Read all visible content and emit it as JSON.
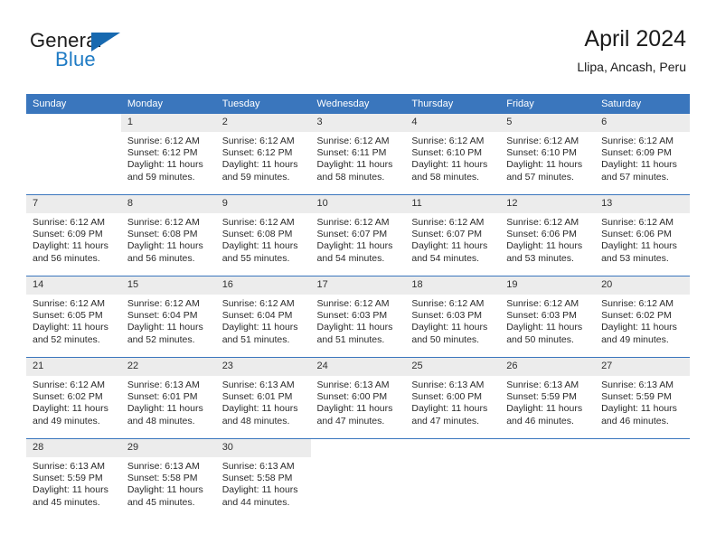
{
  "brand": {
    "name_part1": "General",
    "name_part2": "Blue",
    "triangle_color": "#1769b0",
    "blue_color": "#1f7bc4"
  },
  "header": {
    "title": "April 2024",
    "subtitle": "Llipa, Ancash, Peru"
  },
  "theme": {
    "header_bg": "#3a76bd",
    "daynum_bg": "#ececec",
    "cell_bg": "#ffffff",
    "text_color": "#2a2a2a"
  },
  "weekday_headers": [
    "Sunday",
    "Monday",
    "Tuesday",
    "Wednesday",
    "Thursday",
    "Friday",
    "Saturday"
  ],
  "weeks": [
    [
      {
        "day": "",
        "sunrise": "",
        "sunset": "",
        "daylight": "",
        "empty": true
      },
      {
        "day": "1",
        "sunrise": "Sunrise: 6:12 AM",
        "sunset": "Sunset: 6:12 PM",
        "daylight": "Daylight: 11 hours and 59 minutes.",
        "empty": false
      },
      {
        "day": "2",
        "sunrise": "Sunrise: 6:12 AM",
        "sunset": "Sunset: 6:12 PM",
        "daylight": "Daylight: 11 hours and 59 minutes.",
        "empty": false
      },
      {
        "day": "3",
        "sunrise": "Sunrise: 6:12 AM",
        "sunset": "Sunset: 6:11 PM",
        "daylight": "Daylight: 11 hours and 58 minutes.",
        "empty": false
      },
      {
        "day": "4",
        "sunrise": "Sunrise: 6:12 AM",
        "sunset": "Sunset: 6:10 PM",
        "daylight": "Daylight: 11 hours and 58 minutes.",
        "empty": false
      },
      {
        "day": "5",
        "sunrise": "Sunrise: 6:12 AM",
        "sunset": "Sunset: 6:10 PM",
        "daylight": "Daylight: 11 hours and 57 minutes.",
        "empty": false
      },
      {
        "day": "6",
        "sunrise": "Sunrise: 6:12 AM",
        "sunset": "Sunset: 6:09 PM",
        "daylight": "Daylight: 11 hours and 57 minutes.",
        "empty": false
      }
    ],
    [
      {
        "day": "7",
        "sunrise": "Sunrise: 6:12 AM",
        "sunset": "Sunset: 6:09 PM",
        "daylight": "Daylight: 11 hours and 56 minutes.",
        "empty": false
      },
      {
        "day": "8",
        "sunrise": "Sunrise: 6:12 AM",
        "sunset": "Sunset: 6:08 PM",
        "daylight": "Daylight: 11 hours and 56 minutes.",
        "empty": false
      },
      {
        "day": "9",
        "sunrise": "Sunrise: 6:12 AM",
        "sunset": "Sunset: 6:08 PM",
        "daylight": "Daylight: 11 hours and 55 minutes.",
        "empty": false
      },
      {
        "day": "10",
        "sunrise": "Sunrise: 6:12 AM",
        "sunset": "Sunset: 6:07 PM",
        "daylight": "Daylight: 11 hours and 54 minutes.",
        "empty": false
      },
      {
        "day": "11",
        "sunrise": "Sunrise: 6:12 AM",
        "sunset": "Sunset: 6:07 PM",
        "daylight": "Daylight: 11 hours and 54 minutes.",
        "empty": false
      },
      {
        "day": "12",
        "sunrise": "Sunrise: 6:12 AM",
        "sunset": "Sunset: 6:06 PM",
        "daylight": "Daylight: 11 hours and 53 minutes.",
        "empty": false
      },
      {
        "day": "13",
        "sunrise": "Sunrise: 6:12 AM",
        "sunset": "Sunset: 6:06 PM",
        "daylight": "Daylight: 11 hours and 53 minutes.",
        "empty": false
      }
    ],
    [
      {
        "day": "14",
        "sunrise": "Sunrise: 6:12 AM",
        "sunset": "Sunset: 6:05 PM",
        "daylight": "Daylight: 11 hours and 52 minutes.",
        "empty": false
      },
      {
        "day": "15",
        "sunrise": "Sunrise: 6:12 AM",
        "sunset": "Sunset: 6:04 PM",
        "daylight": "Daylight: 11 hours and 52 minutes.",
        "empty": false
      },
      {
        "day": "16",
        "sunrise": "Sunrise: 6:12 AM",
        "sunset": "Sunset: 6:04 PM",
        "daylight": "Daylight: 11 hours and 51 minutes.",
        "empty": false
      },
      {
        "day": "17",
        "sunrise": "Sunrise: 6:12 AM",
        "sunset": "Sunset: 6:03 PM",
        "daylight": "Daylight: 11 hours and 51 minutes.",
        "empty": false
      },
      {
        "day": "18",
        "sunrise": "Sunrise: 6:12 AM",
        "sunset": "Sunset: 6:03 PM",
        "daylight": "Daylight: 11 hours and 50 minutes.",
        "empty": false
      },
      {
        "day": "19",
        "sunrise": "Sunrise: 6:12 AM",
        "sunset": "Sunset: 6:03 PM",
        "daylight": "Daylight: 11 hours and 50 minutes.",
        "empty": false
      },
      {
        "day": "20",
        "sunrise": "Sunrise: 6:12 AM",
        "sunset": "Sunset: 6:02 PM",
        "daylight": "Daylight: 11 hours and 49 minutes.",
        "empty": false
      }
    ],
    [
      {
        "day": "21",
        "sunrise": "Sunrise: 6:12 AM",
        "sunset": "Sunset: 6:02 PM",
        "daylight": "Daylight: 11 hours and 49 minutes.",
        "empty": false
      },
      {
        "day": "22",
        "sunrise": "Sunrise: 6:13 AM",
        "sunset": "Sunset: 6:01 PM",
        "daylight": "Daylight: 11 hours and 48 minutes.",
        "empty": false
      },
      {
        "day": "23",
        "sunrise": "Sunrise: 6:13 AM",
        "sunset": "Sunset: 6:01 PM",
        "daylight": "Daylight: 11 hours and 48 minutes.",
        "empty": false
      },
      {
        "day": "24",
        "sunrise": "Sunrise: 6:13 AM",
        "sunset": "Sunset: 6:00 PM",
        "daylight": "Daylight: 11 hours and 47 minutes.",
        "empty": false
      },
      {
        "day": "25",
        "sunrise": "Sunrise: 6:13 AM",
        "sunset": "Sunset: 6:00 PM",
        "daylight": "Daylight: 11 hours and 47 minutes.",
        "empty": false
      },
      {
        "day": "26",
        "sunrise": "Sunrise: 6:13 AM",
        "sunset": "Sunset: 5:59 PM",
        "daylight": "Daylight: 11 hours and 46 minutes.",
        "empty": false
      },
      {
        "day": "27",
        "sunrise": "Sunrise: 6:13 AM",
        "sunset": "Sunset: 5:59 PM",
        "daylight": "Daylight: 11 hours and 46 minutes.",
        "empty": false
      }
    ],
    [
      {
        "day": "28",
        "sunrise": "Sunrise: 6:13 AM",
        "sunset": "Sunset: 5:59 PM",
        "daylight": "Daylight: 11 hours and 45 minutes.",
        "empty": false
      },
      {
        "day": "29",
        "sunrise": "Sunrise: 6:13 AM",
        "sunset": "Sunset: 5:58 PM",
        "daylight": "Daylight: 11 hours and 45 minutes.",
        "empty": false
      },
      {
        "day": "30",
        "sunrise": "Sunrise: 6:13 AM",
        "sunset": "Sunset: 5:58 PM",
        "daylight": "Daylight: 11 hours and 44 minutes.",
        "empty": false
      },
      {
        "day": "",
        "sunrise": "",
        "sunset": "",
        "daylight": "",
        "empty": true
      },
      {
        "day": "",
        "sunrise": "",
        "sunset": "",
        "daylight": "",
        "empty": true
      },
      {
        "day": "",
        "sunrise": "",
        "sunset": "",
        "daylight": "",
        "empty": true
      },
      {
        "day": "",
        "sunrise": "",
        "sunset": "",
        "daylight": "",
        "empty": true
      }
    ]
  ]
}
